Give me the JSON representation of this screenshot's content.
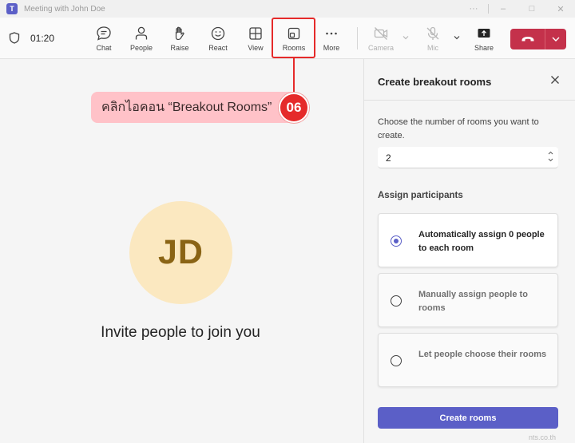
{
  "window": {
    "title": "Meeting with John Doe",
    "controls": [
      "···",
      "–",
      "□",
      "✕"
    ]
  },
  "toolbar": {
    "timer": "01:20",
    "buttons": [
      {
        "label": "Chat",
        "icon": "chat-icon"
      },
      {
        "label": "People",
        "icon": "people-icon"
      },
      {
        "label": "Raise",
        "icon": "raise-hand-icon"
      },
      {
        "label": "React",
        "icon": "smiley-icon"
      },
      {
        "label": "View",
        "icon": "grid-icon"
      },
      {
        "label": "Rooms",
        "icon": "rooms-icon"
      },
      {
        "label": "More",
        "icon": "more-icon"
      },
      {
        "label": "Camera",
        "icon": "camera-off-icon",
        "disabled": true
      },
      {
        "label": "Mic",
        "icon": "mic-off-icon",
        "disabled": true
      },
      {
        "label": "Share",
        "icon": "share-icon"
      }
    ],
    "leave_color": "#c4314b"
  },
  "stage": {
    "avatar_initials": "JD",
    "invite_text": "Invite people to join you"
  },
  "annotation": {
    "callout_text": "คลิกไอคอน “Breakout Rooms”",
    "step_number": "06",
    "color": "#e52a2a"
  },
  "panel": {
    "title": "Create breakout rooms",
    "description": "Choose the number of rooms you want to create.",
    "room_count": "2",
    "assign_heading": "Assign participants",
    "options": [
      {
        "label": "Automatically assign 0 people to each room",
        "selected": true
      },
      {
        "label": "Manually assign people to rooms",
        "selected": false
      },
      {
        "label": "Let people choose their rooms",
        "selected": false
      }
    ],
    "create_button": "Create rooms",
    "accent": "#5b5fc7"
  },
  "watermark": "nts.co.th"
}
